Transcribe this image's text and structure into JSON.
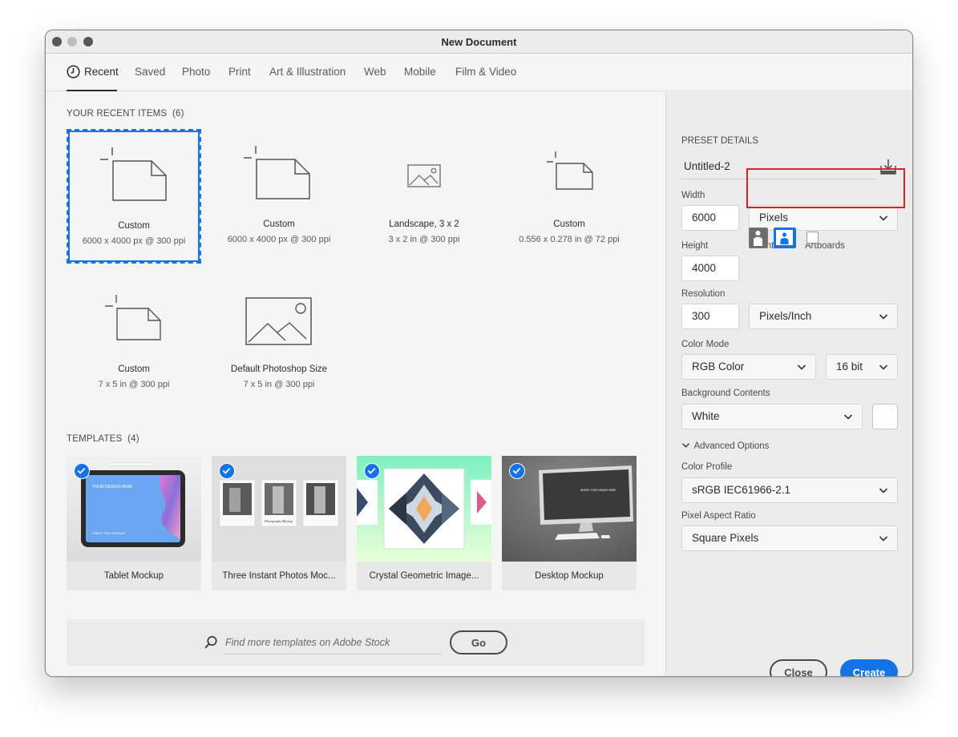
{
  "window": {
    "title": "New Document"
  },
  "tabs": [
    {
      "label": "Recent"
    },
    {
      "label": "Saved"
    },
    {
      "label": "Photo"
    },
    {
      "label": "Print"
    },
    {
      "label": "Art & Illustration"
    },
    {
      "label": "Web"
    },
    {
      "label": "Mobile"
    },
    {
      "label": "Film & Video"
    }
  ],
  "recent": {
    "heading": "YOUR RECENT ITEMS",
    "count": "(6)",
    "items": [
      {
        "name": "Custom",
        "desc": "6000 x 4000 px @ 300 ppi",
        "icon": "custom-document-icon"
      },
      {
        "name": "Custom",
        "desc": "6000 x 4000 px @ 300 ppi",
        "icon": "custom-document-icon"
      },
      {
        "name": "Landscape, 3 x 2",
        "desc": "3 x 2 in @ 300 ppi",
        "icon": "image-icon"
      },
      {
        "name": "Custom",
        "desc": "0.556 x 0.278 in @ 72 ppi",
        "icon": "custom-document-icon"
      },
      {
        "name": "Custom",
        "desc": "7 x 5 in @ 300 ppi",
        "icon": "custom-document-icon"
      },
      {
        "name": "Default Photoshop Size",
        "desc": "7 x 5 in @ 300 ppi",
        "icon": "image-icon"
      }
    ]
  },
  "templates": {
    "heading": "TEMPLATES",
    "count": "(4)",
    "items": [
      {
        "label": "Tablet Mockup"
      },
      {
        "label": "Three Instant Photos Moc..."
      },
      {
        "label": "Crystal Geometric Image..."
      },
      {
        "label": "Desktop Mockup"
      }
    ],
    "tablet_text": "YOUR DESIGN HERE",
    "tablet_sub": "TABLET PRO MOCKUP",
    "photo_caption": "Photography Mockup",
    "desktop_text": "INSERT YOUR DESIGN HERE"
  },
  "search": {
    "placeholder": "Find more templates on Adobe Stock",
    "go_label": "Go"
  },
  "preset": {
    "heading": "PRESET DETAILS",
    "name": "Untitled-2",
    "width_label": "Width",
    "width_value": "6000",
    "width_unit": "Pixels",
    "height_label": "Height",
    "height_value": "4000",
    "orientation_label": "Orientation",
    "artboards_label": "Artboards",
    "resolution_label": "Resolution",
    "resolution_value": "300",
    "resolution_unit": "Pixels/Inch",
    "color_mode_label": "Color Mode",
    "color_mode": "RGB Color",
    "bit_depth": "16 bit",
    "background_label": "Background Contents",
    "background": "White",
    "advanced_label": "Advanced Options",
    "color_profile_label": "Color Profile",
    "color_profile": "sRGB IEC61966-2.1",
    "pixel_aspect_label": "Pixel Aspect Ratio",
    "pixel_aspect": "Square Pixels"
  },
  "buttons": {
    "close": "Close",
    "create": "Create"
  },
  "colors": {
    "accent": "#1473e6",
    "highlight": "#d9202a"
  }
}
